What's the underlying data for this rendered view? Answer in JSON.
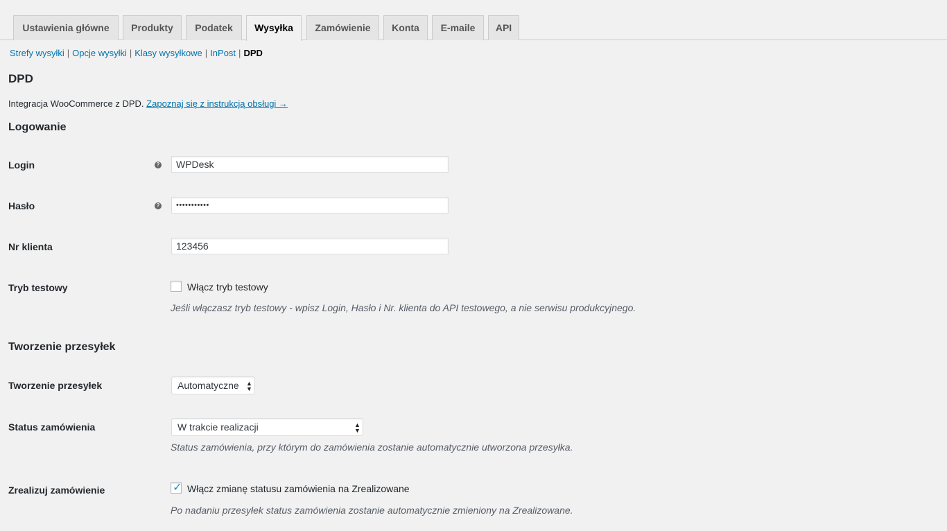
{
  "tabs": [
    {
      "label": "Ustawienia główne"
    },
    {
      "label": "Produkty"
    },
    {
      "label": "Podatek"
    },
    {
      "label": "Wysyłka"
    },
    {
      "label": "Zamówienie"
    },
    {
      "label": "Konta"
    },
    {
      "label": "E-maile"
    },
    {
      "label": "API"
    }
  ],
  "active_tab": "Wysyłka",
  "subnav": {
    "items": [
      "Strefy wysyłki",
      "Opcje wysyłki",
      "Klasy wysyłkowe",
      "InPost"
    ],
    "separator": "|",
    "current": "DPD"
  },
  "page_title": "DPD",
  "description": {
    "text": "Integracja WooCommerce z DPD.",
    "link": "Zapoznaj się z instrukcją obsługi →"
  },
  "sections": {
    "login_title": "Logowanie",
    "shipments_title": "Tworzenie przesyłek"
  },
  "fields": {
    "login": {
      "label": "Login",
      "value": "WPDesk"
    },
    "password": {
      "label": "Hasło",
      "value": "•••••••••••"
    },
    "client_no": {
      "label": "Nr klienta",
      "value": "123456"
    },
    "test_mode": {
      "label": "Tryb testowy",
      "checkbox_label": "Włącz tryb testowy",
      "checked": false,
      "hint": "Jeśli włączasz tryb testowy - wpisz Login, Hasło i Nr. klienta do API testowego, a nie serwisu produkcyjnego."
    },
    "create_shipments": {
      "label": "Tworzenie przesyłek",
      "selected": "Automatyczne"
    },
    "order_status": {
      "label": "Status zamówienia",
      "selected": "W trakcie realizacji",
      "hint": "Status zamówienia, przy którym do zamówienia zostanie automatycznie utworzona przesyłka."
    },
    "complete_order": {
      "label": "Zrealizuj zamówienie",
      "checkbox_label": "Włącz zmianę statusu zamówienia na Zrealizowane",
      "checked": true,
      "hint": "Po nadaniu przesyłek status zamówienia zostanie automatycznie zmieniony na Zrealizowane."
    }
  },
  "icons": {
    "help": "help-icon",
    "check": "checkmark-icon",
    "select_arrows": "select-arrows-icon"
  },
  "colors": {
    "link": "#0073aa",
    "background": "#f1f1f1",
    "checkmark": "#1e8cbe"
  }
}
